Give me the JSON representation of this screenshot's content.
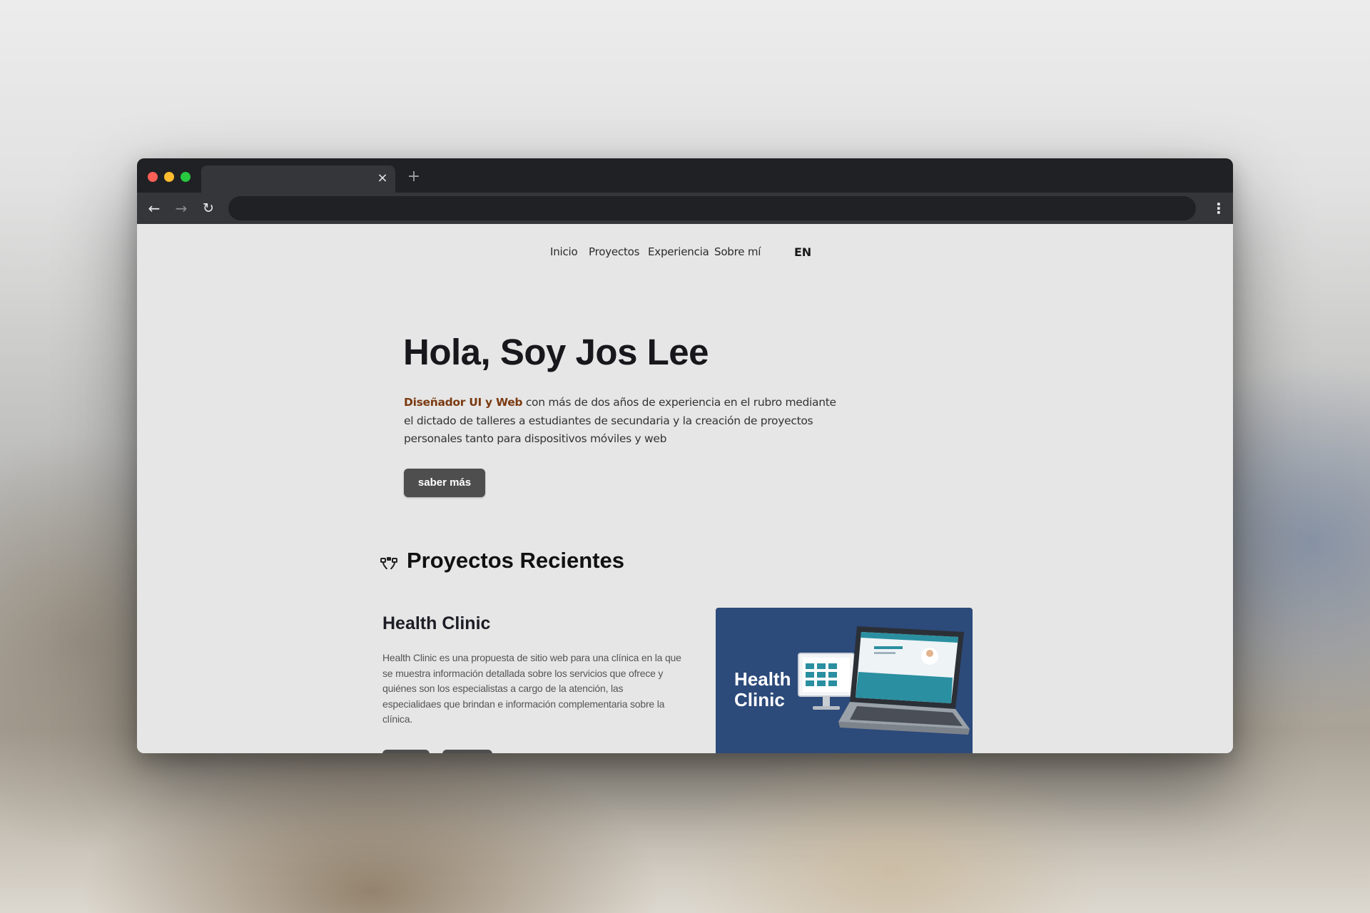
{
  "browser": {
    "tab_close_glyph": "×",
    "new_tab_glyph": "+",
    "back_glyph": "←",
    "forward_glyph": "→",
    "reload_glyph": "↻",
    "menu_glyph": "⋮",
    "colors": {
      "frame": "#202124",
      "toolbar": "#35363a",
      "close_dot": "#ff5f57",
      "minimize_dot": "#febc2e",
      "zoom_dot": "#28c840"
    }
  },
  "site": {
    "nav": {
      "items": [
        "Inicio",
        "Proyectos",
        "Experiencia",
        "Sobre mí"
      ],
      "lang": "EN"
    },
    "hero": {
      "title": "Hola, Soy Jos Lee",
      "highlight": "Diseñador UI y Web",
      "text": " con más de dos años de experiencia en el rubro mediante el dictado de talleres a estudiantes de secundaria y la creación de proyectos personales tanto para dispositivos móviles y web",
      "button": "saber más",
      "highlight_color": "#7a3a12"
    },
    "projects": {
      "section_title": "Proyectos Recientes",
      "section_icon": "bezier-curve-icon",
      "items": [
        {
          "title": "Health Clinic",
          "description": "Health Clinic es una propuesta de sitio web para una clínica en la que se muestra información detallada sobre los servicios que ofrece y quiénes son los especialistas a cargo de la atención, las especialidaes que brindan e información complementaria sobre la clínica.",
          "thumbnail_title": "Health\nClinic",
          "thumbnail_bg": "#2c4a7a"
        }
      ]
    }
  }
}
